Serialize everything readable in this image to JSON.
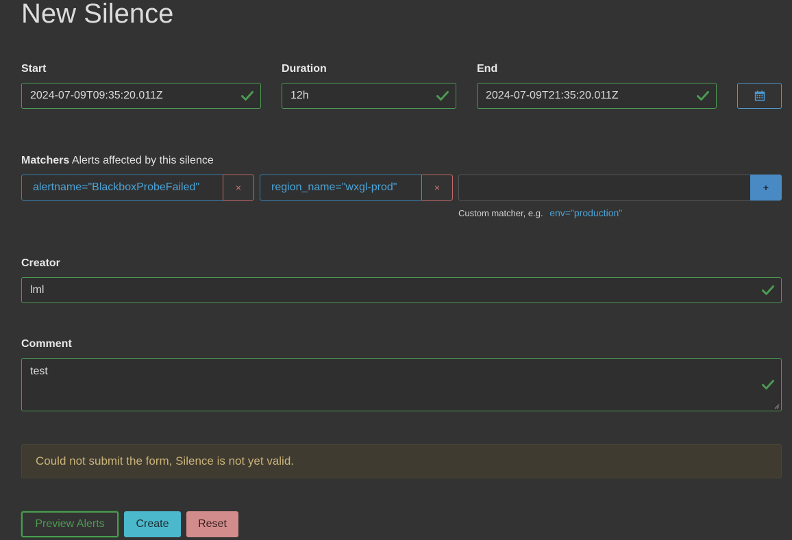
{
  "page": {
    "title": "New Silence"
  },
  "start": {
    "label": "Start",
    "value": "2024-07-09T09:35:20.011Z"
  },
  "duration": {
    "label": "Duration",
    "value": "12h"
  },
  "end": {
    "label": "End",
    "value": "2024-07-09T21:35:20.011Z"
  },
  "matchers": {
    "label": "Matchers",
    "description": "Alerts affected by this silence",
    "items": [
      {
        "text": "alertname=\"BlackboxProbeFailed\"",
        "remove": "×"
      },
      {
        "text": "region_name=\"wxgl-prod\"",
        "remove": "×"
      }
    ],
    "custom_value": "",
    "add_label": "+",
    "hint": "Custom matcher, e.g.",
    "hint_example": "env=\"production\""
  },
  "creator": {
    "label": "Creator",
    "value": "lml"
  },
  "comment": {
    "label": "Comment",
    "value": "test"
  },
  "alert": {
    "message": "Could not submit the form, Silence is not yet valid."
  },
  "buttons": {
    "preview": "Preview Alerts",
    "create": "Create",
    "reset": "Reset"
  },
  "colors": {
    "valid": "#4c9a52",
    "info": "#4ca3d6",
    "danger": "#d07474",
    "warning_text": "#c9b37a"
  }
}
